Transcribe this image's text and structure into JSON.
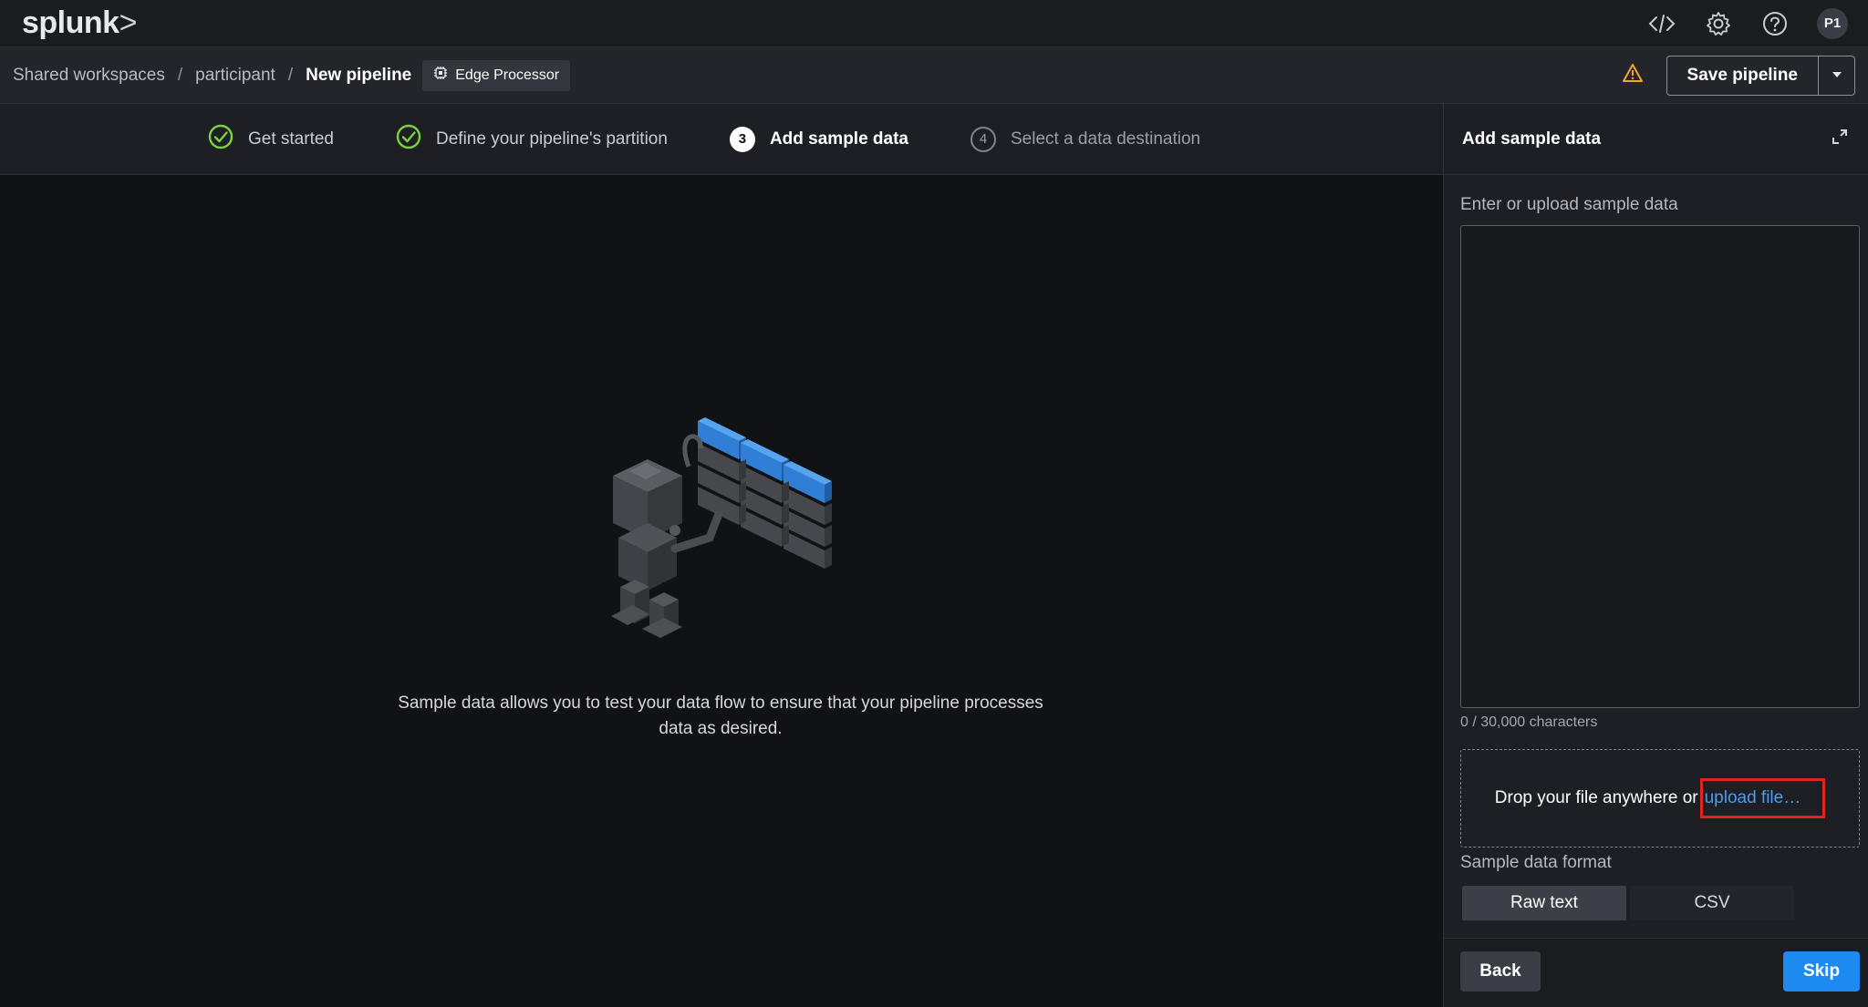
{
  "app": {
    "logo": "splunk",
    "logo_chevron": ">",
    "top_icons": [
      "code-icon",
      "gear-icon",
      "help-icon"
    ],
    "avatar_initials": "P1"
  },
  "breadcrumb": {
    "items": [
      "Shared workspaces",
      "participant"
    ],
    "current": "New pipeline",
    "separator": "/",
    "tag_label": "Edge Processor"
  },
  "header_actions": {
    "save_label": "Save pipeline",
    "warning_icon": "warning-icon"
  },
  "steps": [
    {
      "label": "Get started",
      "state": "done"
    },
    {
      "label": "Define your pipeline's partition",
      "state": "done"
    },
    {
      "label": "Add sample data",
      "state": "active",
      "number": "3"
    },
    {
      "label": "Select a data destination",
      "state": "todo",
      "number": "4"
    }
  ],
  "canvas": {
    "empty_text": "Sample data allows you to test your data flow to ensure that your pipeline processes data as desired."
  },
  "panel": {
    "title": "Add sample data",
    "field_label": "Enter or upload sample data",
    "textarea_value": "",
    "char_count": "0 / 30,000 characters",
    "drop_text": "Drop your file anywhere or",
    "upload_link": "upload file…",
    "format_label": "Sample data format",
    "formats": [
      "Raw text",
      "CSV"
    ],
    "selected_format": "Raw text",
    "back_label": "Back",
    "skip_label": "Skip"
  },
  "colors": {
    "accent": "#1d8af2",
    "success": "#7bd23c",
    "warning": "#f0a72e",
    "highlight_box": "#e0261f"
  }
}
